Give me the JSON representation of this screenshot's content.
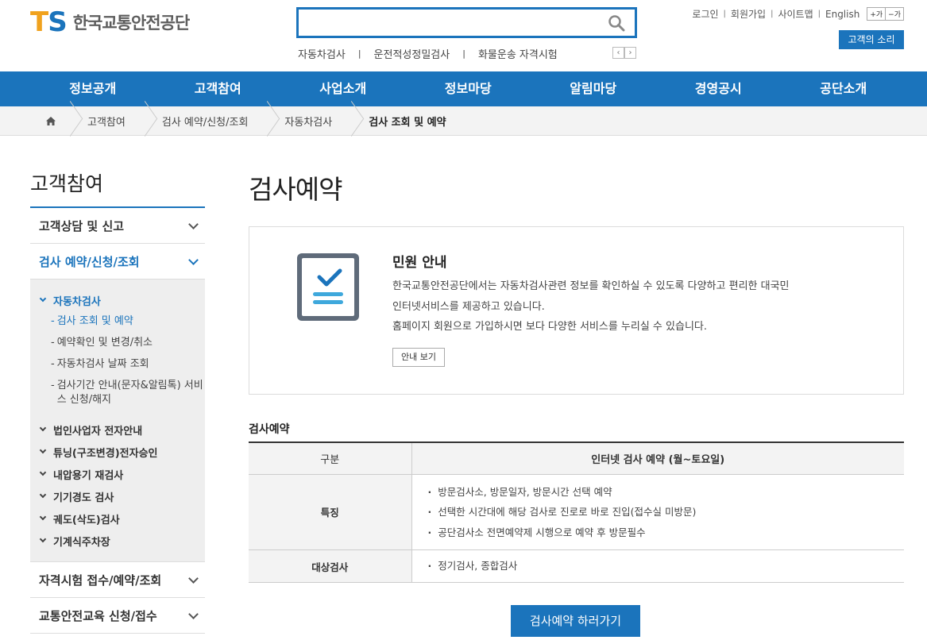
{
  "header": {
    "logo_mark_t": "T",
    "logo_mark_s": "S",
    "logo_text": "한국교통안전공단",
    "search_placeholder": "",
    "quick_links": [
      "자동차검사",
      "운전적성정밀검사",
      "화물운송 자격시험"
    ],
    "util_links": [
      "로그인",
      "회원가입",
      "사이트맵",
      "English"
    ],
    "font_plus": "+가",
    "font_minus": "−가",
    "voice_button": "고객의 소리"
  },
  "gnb": [
    "정보공개",
    "고객참여",
    "사업소개",
    "정보마당",
    "알림마당",
    "경영공시",
    "공단소개"
  ],
  "breadcrumb": [
    "고객참여",
    "검사 예약/신청/조회",
    "자동차검사",
    "검사 조회 및 예약"
  ],
  "lnb": {
    "title": "고객참여",
    "d1_counsel": "고객상담 및 신고",
    "d1_inspect": "검사 예약/신청/조회",
    "d2_car": "자동차검사",
    "d3_items": [
      "검사 조회 및 예약",
      "예약확인 및 변경/취소",
      "자동차검사 날짜 조회",
      "검사기간 안내(문자&알림톡) 서비스 신청/해지"
    ],
    "d2_others": [
      "법인사업자 전자안내",
      "튜닝(구조변경)전자승인",
      "내압용기 재검사",
      "기기경도 검사",
      "궤도(삭도)검사",
      "기계식주차장"
    ],
    "d1_license": "자격시험 접수/예약/조회",
    "d1_edu": "교통안전교육 신청/접수"
  },
  "content": {
    "page_title": "검사예약",
    "info_title": "민원 안내",
    "info_lines": [
      "한국교통안전공단에서는 자동차검사관련 정보를 확인하실 수 있도록 다양하고 편리한 대국민",
      "인터넷서비스를 제공하고 있습니다.",
      "홈페이지 회원으로 가입하시면 보다 다양한 서비스를 누리실 수 있습니다."
    ],
    "info_button": "안내 보기",
    "section_title": "검사예약",
    "table": {
      "head": [
        "구분",
        "인터넷 검사 예약 (월~토요일)"
      ],
      "row1_key": "특징",
      "row1_items": [
        "방문검사소, 방문일자, 방문시간 선택 예약",
        "선택한 시간대에 해당 검사로 진로로 바로 진입(접수실 미방문)",
        "공단검사소 전면예약제 시행으로 예약 후 방문필수"
      ],
      "row2_key": "대상검사",
      "row2_items": [
        "정기검사, 종합검사"
      ]
    },
    "go_button": "검사예약 하러가기"
  },
  "colors": {
    "primary": "#1b74bc",
    "logo_orange": "#f0a21e"
  }
}
